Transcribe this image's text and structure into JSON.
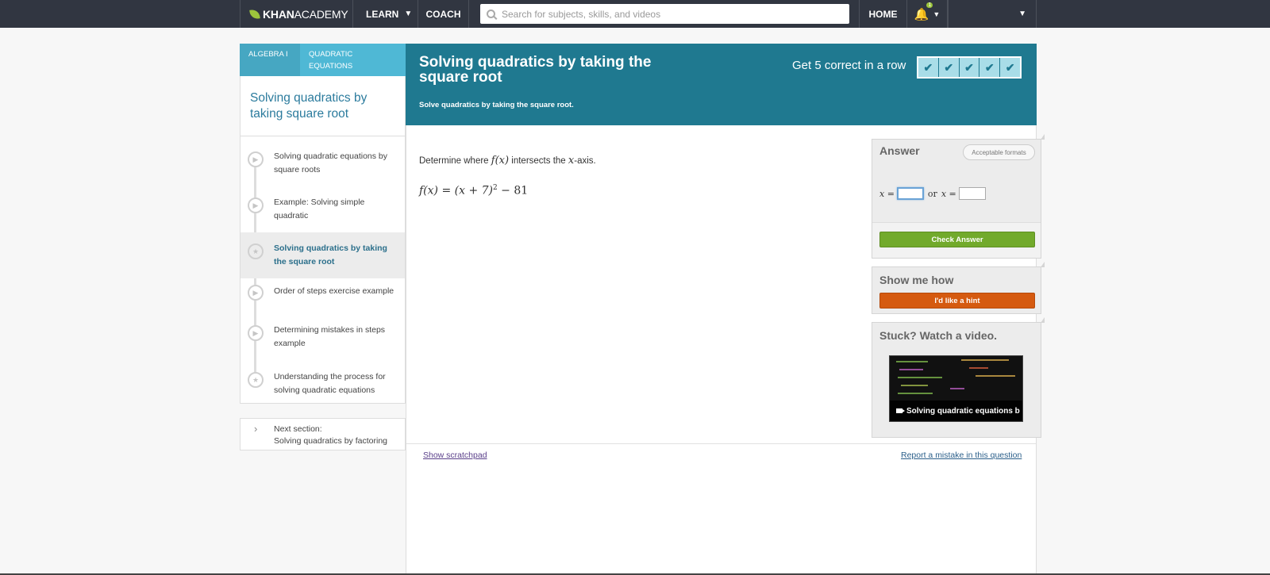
{
  "nav": {
    "logo_khan": "KHAN",
    "logo_academy": "ACADEMY",
    "learn": "LEARN",
    "coach": "COACH",
    "search_placeholder": "Search for subjects, skills, and videos",
    "home": "HOME",
    "notification_count": "1"
  },
  "breadcrumb": {
    "tab1": "ALGEBRA I",
    "tab2": "QUADRATIC EQUATIONS"
  },
  "sidebar": {
    "title": "Solving quadratics by taking square root",
    "items": [
      {
        "label": "Solving quadratic equations by square roots",
        "type": "video"
      },
      {
        "label": "Example: Solving simple quadratic",
        "type": "video"
      },
      {
        "label": "Solving quadratics by taking the square root",
        "type": "exercise"
      },
      {
        "label": "Order of steps exercise example",
        "type": "video"
      },
      {
        "label": "Determining mistakes in steps example",
        "type": "video"
      },
      {
        "label": "Understanding the process for solving quadratic equations",
        "type": "exercise"
      }
    ],
    "next_label": "Next section:",
    "next_title": "Solving quadratics by factoring"
  },
  "exercise": {
    "title": "Solving quadratics by taking the square root",
    "subtitle": "Solve quadratics by taking the square root.",
    "streak_label": "Get 5 correct in a row",
    "streak_correct": 5,
    "streak_total": 5,
    "question_prefix": "Determine where",
    "question_fx": "f(x)",
    "question_mid": "intersects the",
    "question_x": "x",
    "question_suffix": "-axis.",
    "equation_lhs": "f(x) = (x + 7)",
    "equation_exp": "2",
    "equation_rhs": " − 81"
  },
  "answer": {
    "title": "Answer",
    "formats": "Acceptable formats",
    "x_label1": "x =",
    "or": "or",
    "x_label2": "x =",
    "value1": "",
    "value2": "",
    "check": "Check Answer"
  },
  "hint": {
    "title": "Show me how",
    "button": "I'd like a hint"
  },
  "video": {
    "title": "Stuck? Watch a video.",
    "caption": "Solving quadratic equations b"
  },
  "footer": {
    "scratchpad": "Show scratchpad",
    "report": "Report a mistake in this question"
  },
  "colors": {
    "nav_bg": "#313641",
    "banner": "#1f7990",
    "tab_blue": "#4fb8d5",
    "check_green": "#72aa2c",
    "hint_orange": "#d55a10",
    "logo_green": "#9cc53c"
  }
}
